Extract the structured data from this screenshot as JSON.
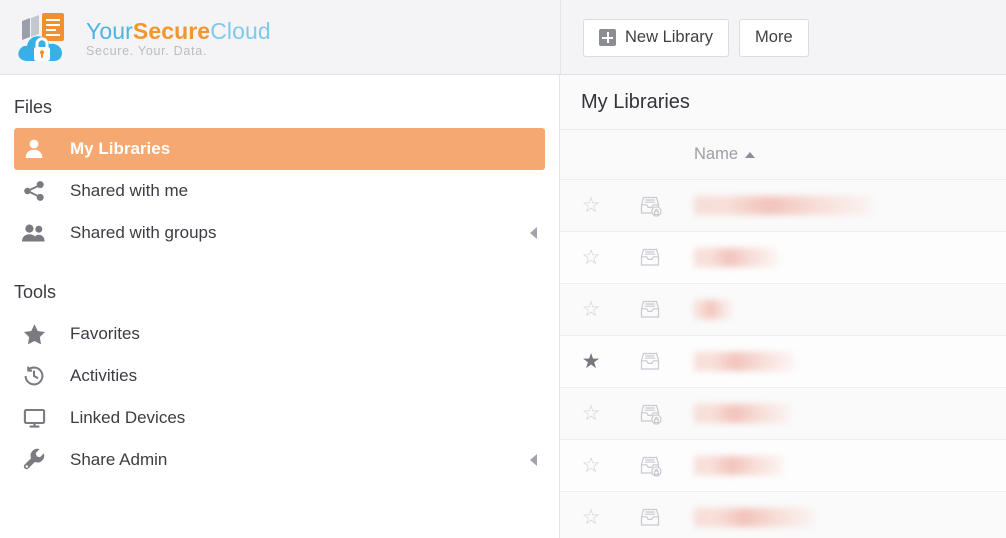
{
  "brand": {
    "title_part1": "Your",
    "title_part2": "Secure",
    "title_part3": "Cloud",
    "tagline": "Secure. Your. Data.",
    "logo_icon": "cloud-lock-document-logo",
    "colors": {
      "blue": "#4fb3e3",
      "orange": "#f2962d",
      "light_blue": "#7fc9ea",
      "tagline": "#b9bcc4"
    }
  },
  "toolbar": {
    "new_library_label": "New Library",
    "new_library_icon": "plus-square-icon",
    "more_label": "More"
  },
  "sidebar": {
    "sections": [
      {
        "title": "Files",
        "items": [
          {
            "label": "My Libraries",
            "icon": "user-icon",
            "active": true,
            "collapsible": false
          },
          {
            "label": "Shared with me",
            "icon": "share-nodes-icon",
            "active": false,
            "collapsible": false
          },
          {
            "label": "Shared with groups",
            "icon": "users-group-icon",
            "active": false,
            "collapsible": true
          }
        ]
      },
      {
        "title": "Tools",
        "items": [
          {
            "label": "Favorites",
            "icon": "star-icon",
            "active": false,
            "collapsible": false
          },
          {
            "label": "Activities",
            "icon": "history-icon",
            "active": false,
            "collapsible": false
          },
          {
            "label": "Linked Devices",
            "icon": "monitor-icon",
            "active": false,
            "collapsible": false
          },
          {
            "label": "Share Admin",
            "icon": "wrench-icon",
            "active": false,
            "collapsible": true
          }
        ]
      }
    ],
    "collapse_icon": "caret-left-icon",
    "active_color": "#f5a86f"
  },
  "main": {
    "title": "My Libraries",
    "columns": {
      "star": "",
      "icon": "",
      "name": "Name"
    },
    "sort": {
      "column": "Name",
      "direction": "ascending",
      "icon": "caret-up-icon"
    },
    "rows": [
      {
        "favorite": false,
        "icon": "library-encrypted-icon",
        "name": "",
        "name_redacted": true,
        "redacted_width": 178
      },
      {
        "favorite": false,
        "icon": "library-icon",
        "name": "",
        "name_redacted": true,
        "redacted_width": 84
      },
      {
        "favorite": false,
        "icon": "library-icon",
        "name": "",
        "name_redacted": true,
        "redacted_width": 38
      },
      {
        "favorite": true,
        "icon": "library-icon",
        "name": "",
        "name_redacted": true,
        "redacted_width": 100
      },
      {
        "favorite": false,
        "icon": "library-encrypted-icon",
        "name": "",
        "name_redacted": true,
        "redacted_width": 96
      },
      {
        "favorite": false,
        "icon": "library-encrypted-icon",
        "name": "",
        "name_redacted": true,
        "redacted_width": 90
      },
      {
        "favorite": false,
        "icon": "library-icon",
        "name": "",
        "name_redacted": true,
        "redacted_width": 120
      }
    ],
    "star_filled_glyph": "★",
    "star_empty_glyph": "☆"
  }
}
